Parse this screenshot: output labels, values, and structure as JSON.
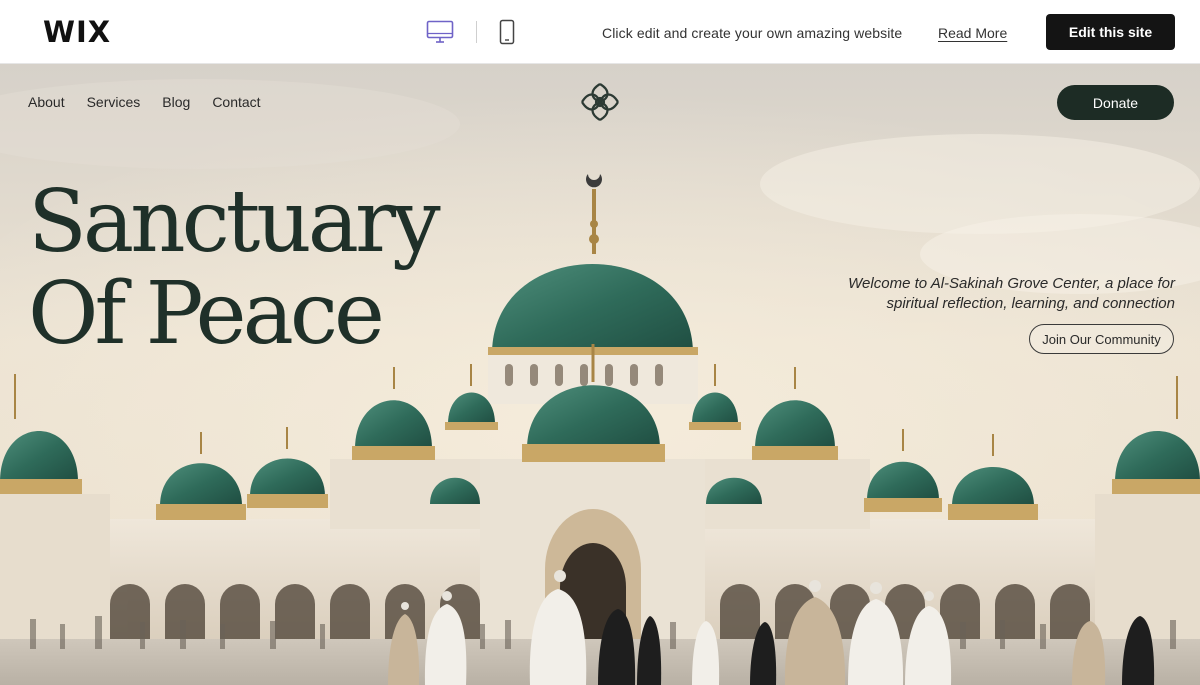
{
  "wixbar": {
    "logo": "WIX",
    "device_icons": [
      "desktop-icon",
      "mobile-icon"
    ],
    "tagline": "Click edit and create your own amazing website",
    "read_more": "Read More",
    "edit_button": "Edit this site"
  },
  "site": {
    "nav": [
      {
        "label": "About"
      },
      {
        "label": "Services"
      },
      {
        "label": "Blog"
      },
      {
        "label": "Contact"
      }
    ],
    "logo_icon": "knot-emblem-icon",
    "donate": "Donate",
    "headline": [
      "Sanctuary",
      "Of Peace"
    ],
    "welcome_line1": "Welcome to Al-Sakinah Grove Center, a place for",
    "welcome_line2": "spiritual reflection, learning, and connection",
    "join_button": "Join Our Community"
  },
  "colors": {
    "headline": "#1f3029",
    "donate_bg": "#1d2c25",
    "dome_green": "#2f6b5a",
    "gold": "#b8934a",
    "device_active": "#6f63c7"
  }
}
